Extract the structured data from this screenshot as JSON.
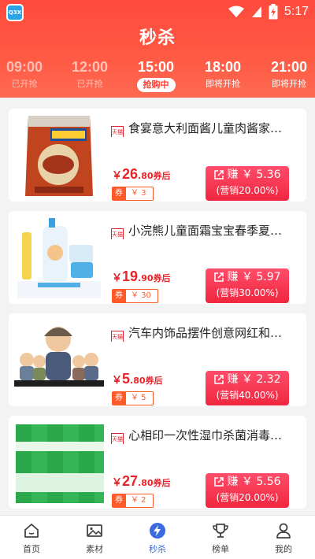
{
  "status": {
    "time": "5:17",
    "app_icon_text": "Q3X"
  },
  "title": "秒杀",
  "slots": [
    {
      "time": "09:00",
      "status": "已开抢"
    },
    {
      "time": "12:00",
      "status": "已开抢"
    },
    {
      "time": "15:00",
      "status": "抢购中"
    },
    {
      "time": "18:00",
      "status": "即将开抢"
    },
    {
      "time": "21:00",
      "status": "即将开抢"
    }
  ],
  "badge_text": "天猫",
  "currency": "￥",
  "coupon_label": "券",
  "products": [
    {
      "name": "食宴意大利面酱儿童肉酱家…",
      "price_int": "26",
      "price_dec": ".80",
      "price_suffix": "券后",
      "coupon": "￥ 3",
      "earn": "赚 ￥ 5.36",
      "rate": "(营销20.00%)"
    },
    {
      "name": "小浣熊儿童面霜宝宝春季夏…",
      "price_int": "19",
      "price_dec": ".90",
      "price_suffix": "券后",
      "coupon": "￥ 30",
      "earn": "赚 ￥ 5.97",
      "rate": "(营销30.00%)"
    },
    {
      "name": "汽车内饰品摆件创意网红和…",
      "price_int": "5",
      "price_dec": ".80",
      "price_suffix": "券后",
      "coupon": "￥ 5",
      "earn": "赚 ￥ 2.32",
      "rate": "(营销40.00%)"
    },
    {
      "name": "心相印一次性湿巾杀菌消毒…",
      "price_int": "27",
      "price_dec": ".80",
      "price_suffix": "券后",
      "coupon": "￥ 2",
      "earn": "赚 ￥ 5.56",
      "rate": "(营销20.00%)"
    }
  ],
  "tabs": [
    {
      "label": "首页",
      "icon": "home-icon"
    },
    {
      "label": "素材",
      "icon": "image-icon"
    },
    {
      "label": "秒杀",
      "icon": "flash-icon"
    },
    {
      "label": "榜单",
      "icon": "trophy-icon"
    },
    {
      "label": "我的",
      "icon": "user-icon"
    }
  ],
  "colors": {
    "header": "#ff4a3d",
    "price": "#e8232a",
    "earn": "#f0263f",
    "tab_active": "#3c6be0"
  }
}
